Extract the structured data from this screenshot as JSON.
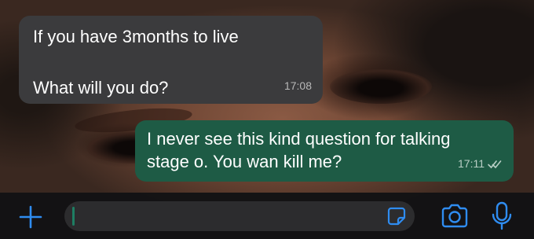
{
  "messages": [
    {
      "direction": "incoming",
      "line1": "If you have 3months to live",
      "line2": "What will you do?",
      "time": "17:08"
    },
    {
      "direction": "outgoing",
      "text": "I never see this kind question for talking stage o. You wan kill me?",
      "time": "17:11",
      "status": "read"
    }
  ],
  "composer": {
    "plus_icon": "plus-icon",
    "sticker_icon": "sticker-icon",
    "camera_icon": "camera-icon",
    "mic_icon": "microphone-icon",
    "value": ""
  },
  "colors": {
    "incoming_bubble": "#3b3b3d",
    "outgoing_bubble": "#1e5b45",
    "accent": "#2f8cf0"
  }
}
